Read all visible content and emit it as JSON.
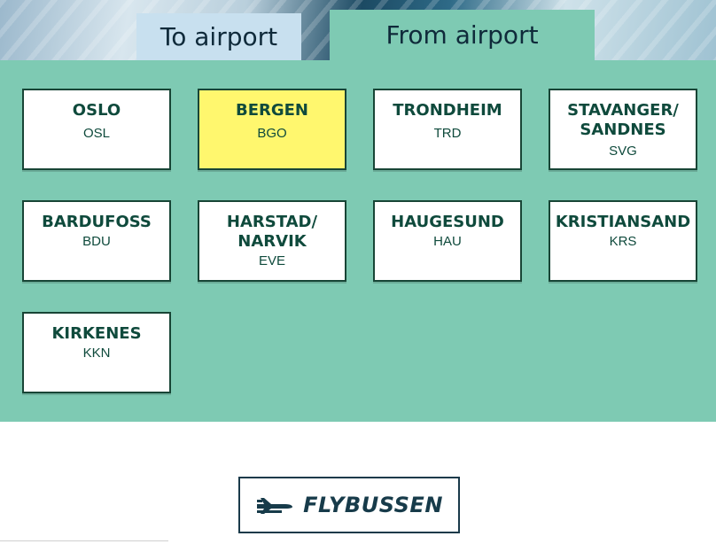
{
  "tabs": [
    {
      "label": "To airport",
      "selected": false
    },
    {
      "label": "From airport",
      "selected": true
    }
  ],
  "airports": [
    {
      "city": "OSLO",
      "code": "OSL",
      "selected": false
    },
    {
      "city": "BERGEN",
      "code": "BGO",
      "selected": true
    },
    {
      "city": "TRONDHEIM",
      "code": "TRD",
      "selected": false
    },
    {
      "city": "STAVANGER/\nSANDNES",
      "code": "SVG",
      "selected": false
    },
    {
      "city": "BARDUFOSS",
      "code": "BDU",
      "selected": false
    },
    {
      "city": "HARSTAD/\nNARVIK",
      "code": "EVE",
      "selected": false
    },
    {
      "city": "HAUGESUND",
      "code": "HAU",
      "selected": false
    },
    {
      "city": "KRISTIANSAND",
      "code": "KRS",
      "selected": false
    },
    {
      "city": "KIRKENES",
      "code": "KKN",
      "selected": false
    }
  ],
  "logo": {
    "text": "FLYBUSSEN",
    "icon": "airplane-icon"
  },
  "colors": {
    "panel": "#7ecab3",
    "selected_card": "#fff76e",
    "tab_inactive": "#c8e0ef",
    "text_dark": "#0f4a3c"
  }
}
